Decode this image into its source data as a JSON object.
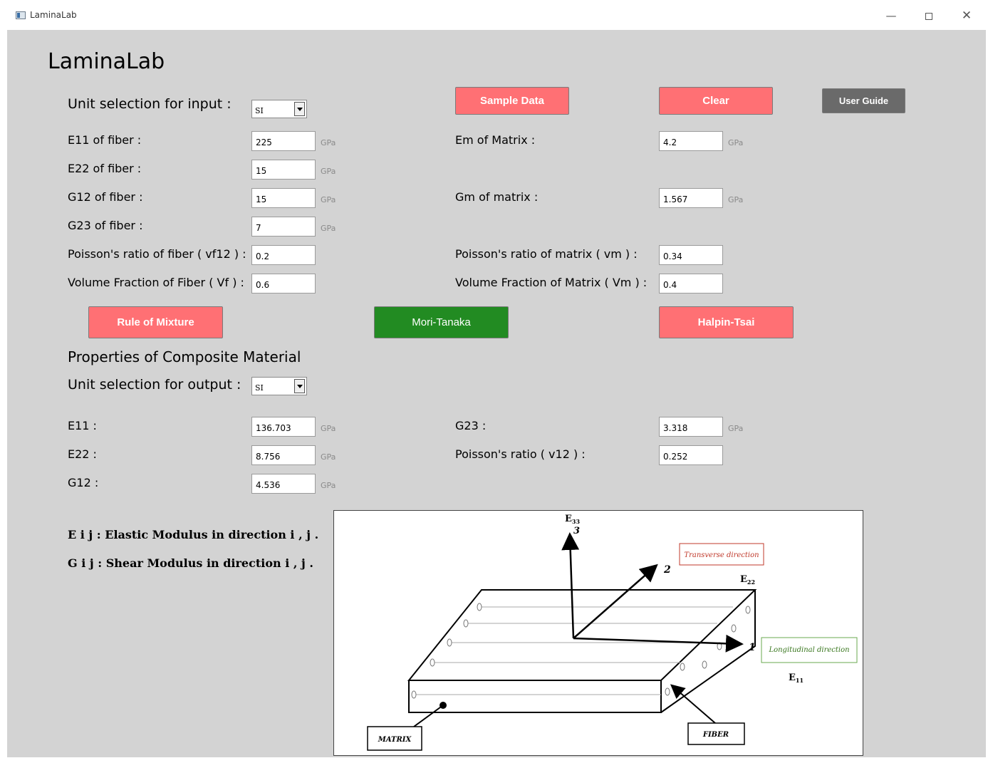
{
  "window": {
    "title": "LaminaLab",
    "minimize": "—",
    "close": "✕"
  },
  "app": {
    "heading": "LaminaLab"
  },
  "input": {
    "unit_label": "Unit selection for input :",
    "unit_value": "SI",
    "e11_label": "E11 of fiber :",
    "e11_value": "225",
    "e11_unit": "GPa",
    "e22_label": "E22 of fiber :",
    "e22_value": "15",
    "e22_unit": "GPa",
    "g12_label": "G12 of fiber :",
    "g12_value": "15",
    "g12_unit": "GPa",
    "g23_label": "G23 of fiber :",
    "g23_value": "7",
    "g23_unit": "GPa",
    "vf12_label": "Poisson's ratio of fiber ( vf12 ) :",
    "vf12_value": "0.2",
    "vf_label": "Volume Fraction of Fiber ( Vf ) :",
    "vf_value": "0.6",
    "em_label": "Em of Matrix :",
    "em_value": "4.2",
    "em_unit": "GPa",
    "gm_label": "Gm of matrix :",
    "gm_value": "1.567",
    "gm_unit": "GPa",
    "vm_ratio_label": "Poisson's ratio of matrix ( vm ) :",
    "vm_ratio_value": "0.34",
    "vm_frac_label": "Volume Fraction of Matrix ( Vm ) :",
    "vm_frac_value": "0.4"
  },
  "buttons": {
    "sample": "Sample Data",
    "clear": "Clear",
    "guide": "User Guide",
    "rule": "Rule of Mixture",
    "mori": "Mori-Tanaka",
    "halpin": "Halpin-Tsai"
  },
  "output": {
    "heading": "Properties of Composite Material",
    "unit_label": "Unit selection for output :",
    "unit_value": "SI",
    "e11_label": "E11 :",
    "e11_value": "136.703",
    "e11_unit": "GPa",
    "e22_label": "E22 :",
    "e22_value": "8.756",
    "e22_unit": "GPa",
    "g12_label": "G12 :",
    "g12_value": "4.536",
    "g12_unit": "GPa",
    "g23_label": "G23 :",
    "g23_value": "3.318",
    "g23_unit": "GPa",
    "v12_label": "Poisson's ratio ( v12 ) :",
    "v12_value": "0.252"
  },
  "legend": {
    "eij": "E i j : Elastic Modulus in direction i , j .",
    "gij": "G i j : Shear Modulus in direction i , j ."
  },
  "diagram": {
    "e33": "E",
    "e33_sub": "33",
    "axis3": "3",
    "axis2": "2",
    "axis1": "1",
    "e22": "E",
    "e22_sub": "22",
    "e11": "E",
    "e11_sub": "11",
    "transverse": "Transverse direction",
    "longitudinal": "Longitudinal direction",
    "matrix": "MATRIX",
    "fiber": "FIBER"
  }
}
